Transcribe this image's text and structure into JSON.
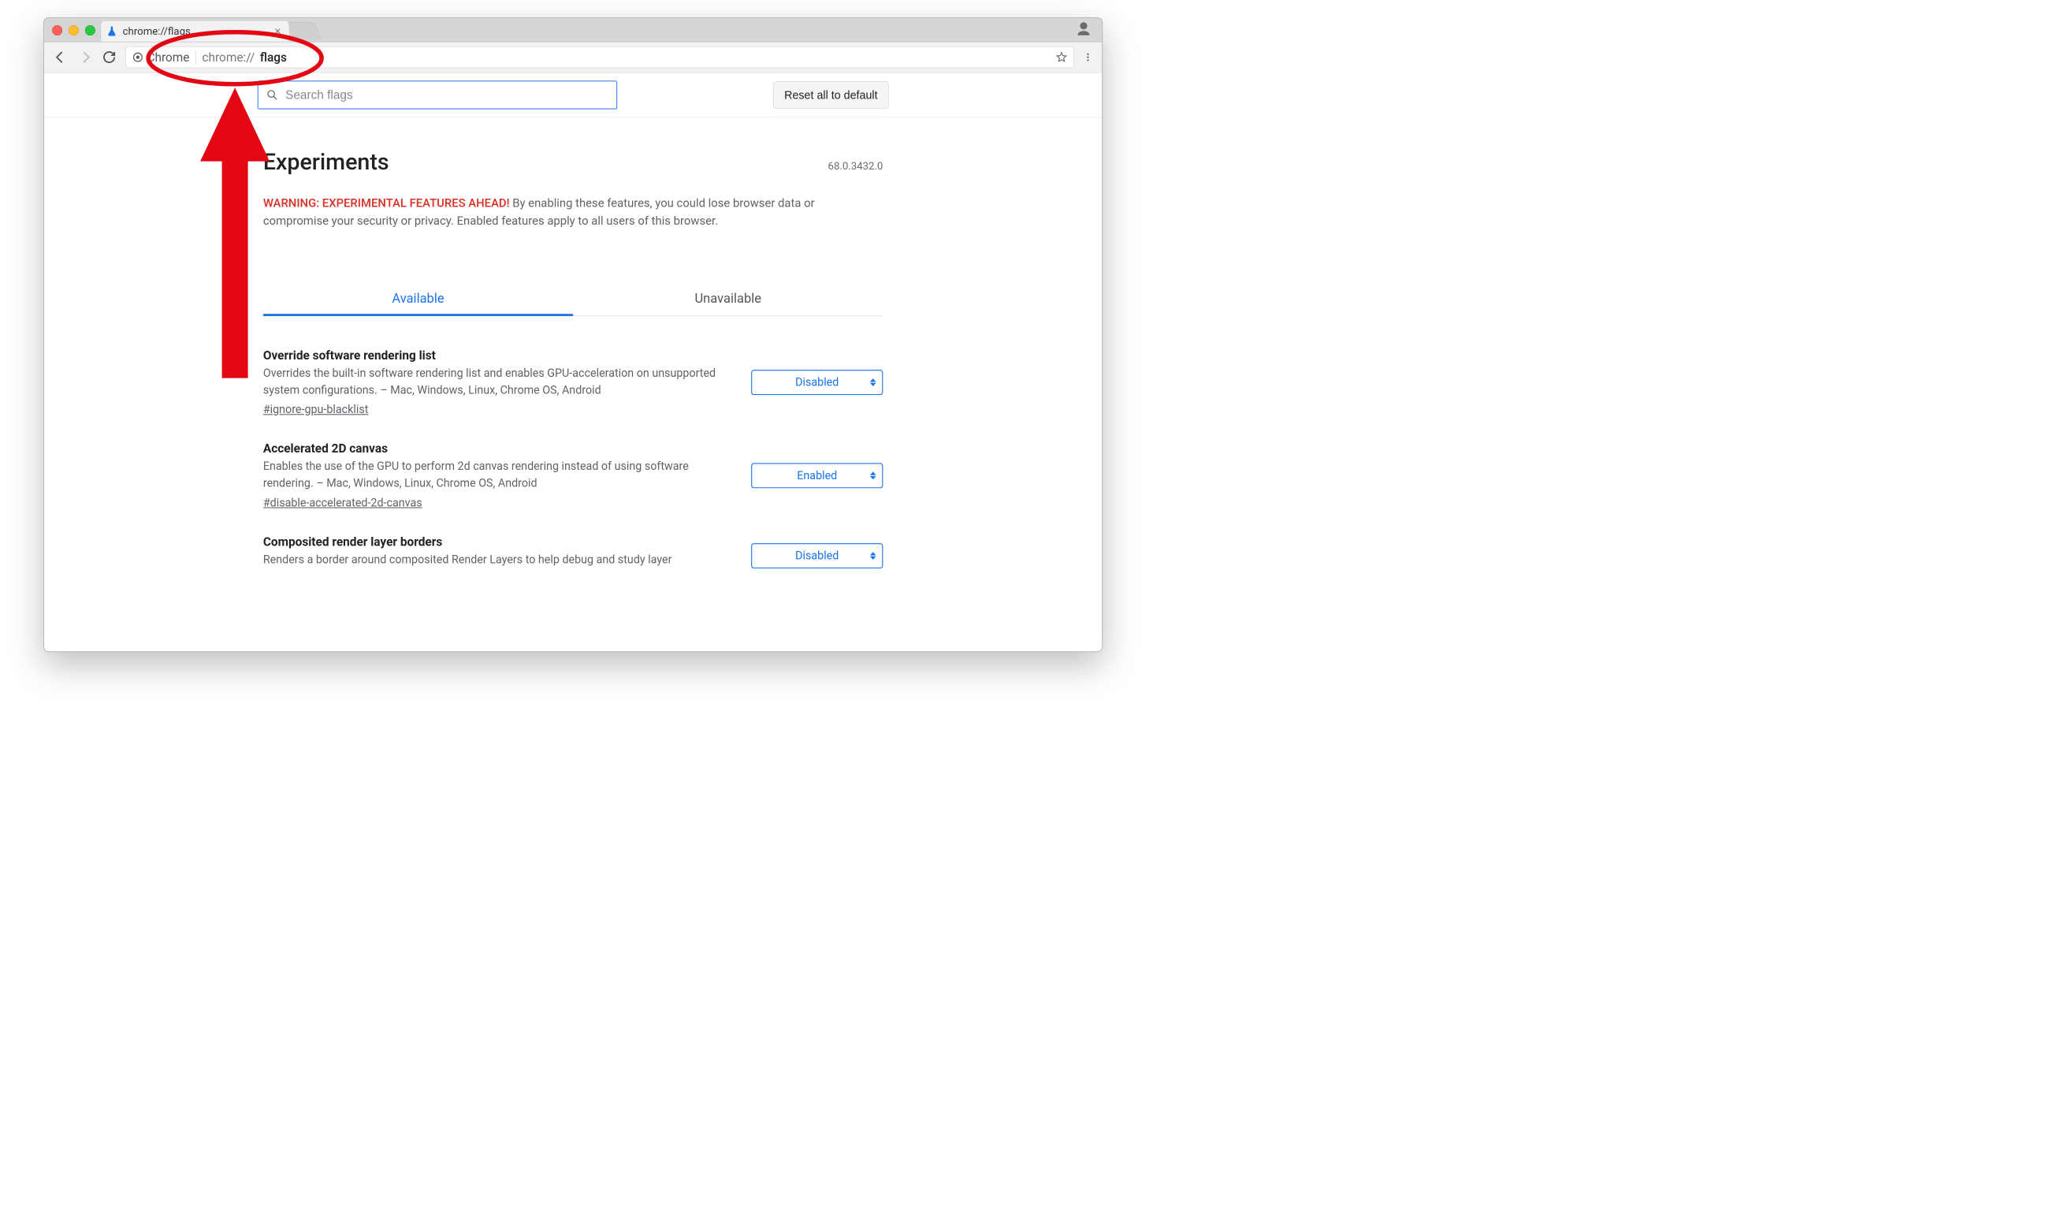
{
  "tab": {
    "title": "chrome://flags"
  },
  "toolbar": {
    "chip_label": "Chrome",
    "url_scheme": "chrome://",
    "url_path": "flags"
  },
  "search": {
    "placeholder": "Search flags"
  },
  "reset_label": "Reset all to default",
  "page": {
    "heading": "Experiments",
    "version": "68.0.3432.0",
    "warning_front": "WARNING: EXPERIMENTAL FEATURES AHEAD!",
    "warning_rest": " By enabling these features, you could lose browser data or compromise your security or privacy. Enabled features apply to all users of this browser."
  },
  "tabs": {
    "available": "Available",
    "unavailable": "Unavailable"
  },
  "flags": [
    {
      "title": "Override software rendering list",
      "desc": "Overrides the built-in software rendering list and enables GPU-acceleration on unsupported system configurations. – Mac, Windows, Linux, Chrome OS, Android",
      "anchor": "#ignore-gpu-blacklist",
      "state": "Disabled"
    },
    {
      "title": "Accelerated 2D canvas",
      "desc": "Enables the use of the GPU to perform 2d canvas rendering instead of using software rendering. – Mac, Windows, Linux, Chrome OS, Android",
      "anchor": "#disable-accelerated-2d-canvas",
      "state": "Enabled"
    },
    {
      "title": "Composited render layer borders",
      "desc": "Renders a border around composited Render Layers to help debug and study layer",
      "anchor": "",
      "state": "Disabled"
    }
  ]
}
